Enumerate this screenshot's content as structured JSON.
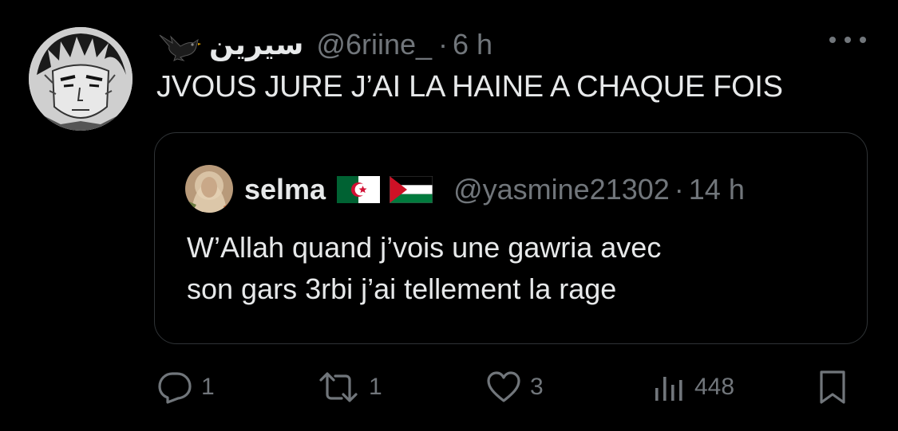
{
  "tweet": {
    "display_name": "سيرين",
    "handle": "@6riine_",
    "separator": "·",
    "time": "6 h",
    "text": "JVOUS JURE J’AI LA HAINE A CHAQUE FOIS"
  },
  "quoted_tweet": {
    "display_name": "selma",
    "flags": [
      "algeria-flag",
      "palestine-flag"
    ],
    "handle": "@yasmine21302",
    "separator": "·",
    "time": "14 h",
    "text_line_1": "W’Allah quand j’vois une gawria avec",
    "text_line_2": "son gars 3rbi j’ai tellement la rage"
  },
  "actions": {
    "replies": "1",
    "retweets": "1",
    "likes": "3",
    "views": "448"
  },
  "colors": {
    "background": "#000000",
    "text": "#e7e9ea",
    "muted": "#71767b",
    "border": "#2f3336"
  }
}
